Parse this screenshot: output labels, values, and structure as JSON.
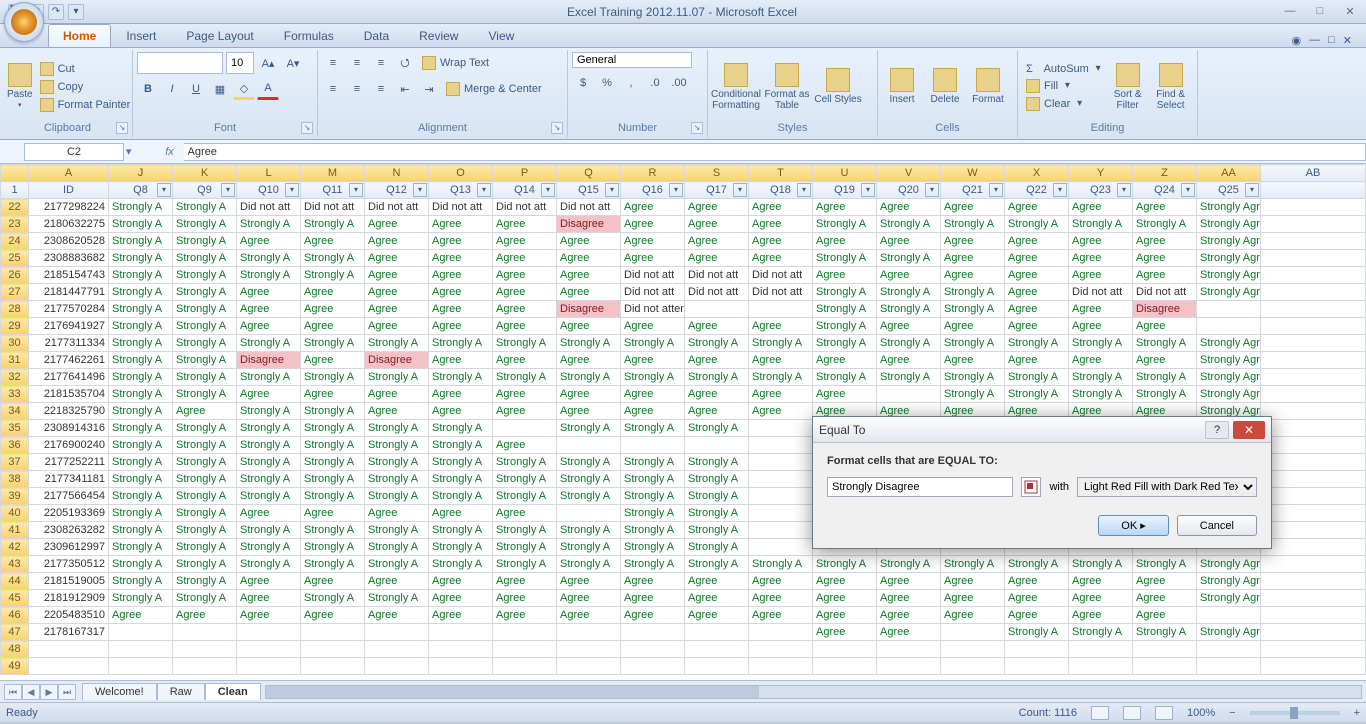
{
  "title": "Excel Training 2012.11.07 - Microsoft Excel",
  "tabs": [
    "Home",
    "Insert",
    "Page Layout",
    "Formulas",
    "Data",
    "Review",
    "View"
  ],
  "clipboard": {
    "paste": "Paste",
    "cut": "Cut",
    "copy": "Copy",
    "fp": "Format Painter",
    "label": "Clipboard"
  },
  "font_group": {
    "font": "",
    "size": "10",
    "label": "Font"
  },
  "align_group": {
    "wrap": "Wrap Text",
    "merge": "Merge & Center",
    "label": "Alignment"
  },
  "num_group": {
    "style": "General",
    "label": "Number"
  },
  "styles_group": {
    "cf": "Conditional Formatting",
    "fat": "Format as Table",
    "cs": "Cell Styles",
    "label": "Styles"
  },
  "cells_group": {
    "ins": "Insert",
    "del": "Delete",
    "fmt": "Format",
    "label": "Cells"
  },
  "edit_group": {
    "as": "AutoSum",
    "fill": "Fill",
    "clear": "Clear",
    "sort": "Sort & Filter",
    "find": "Find & Select",
    "label": "Editing"
  },
  "namebox": "C2",
  "formula": "Agree",
  "col_letters": [
    "",
    "A",
    "J",
    "K",
    "L",
    "M",
    "N",
    "O",
    "P",
    "Q",
    "R",
    "S",
    "T",
    "U",
    "V",
    "W",
    "X",
    "Y",
    "Z",
    "AA",
    "AB"
  ],
  "headers": [
    "",
    "ID",
    "Q8",
    "Q9",
    "Q10",
    "Q11",
    "Q12",
    "Q13",
    "Q14",
    "Q15",
    "Q16",
    "Q17",
    "Q18",
    "Q19",
    "Q20",
    "Q21",
    "Q22",
    "Q23",
    "Q24",
    "Q25",
    ""
  ],
  "rows": [
    {
      "n": "1",
      "hdr": true
    },
    {
      "n": "22",
      "id": "2177298224",
      "c": [
        "Strongly A",
        "Strongly A",
        "Did not att",
        "Did not att",
        "Did not att",
        "Did not att",
        "Did not att",
        "Did not att",
        "Agree",
        "Agree",
        "Agree",
        "Agree",
        "Agree",
        "Agree",
        "Agree",
        "Agree",
        "Agree",
        "Strongly Agree"
      ]
    },
    {
      "n": "23",
      "id": "2180632275",
      "c": [
        "Strongly A",
        "Strongly A",
        "Strongly A",
        "Strongly A",
        "Agree",
        "Agree",
        "Agree",
        "Disagree",
        "Agree",
        "Agree",
        "Agree",
        "Strongly A",
        "Strongly A",
        "Strongly A",
        "Strongly A",
        "Strongly A",
        "Strongly A",
        "Strongly Agree"
      ]
    },
    {
      "n": "24",
      "id": "2308620528",
      "c": [
        "Strongly A",
        "Strongly A",
        "Agree",
        "Agree",
        "Agree",
        "Agree",
        "Agree",
        "Agree",
        "Agree",
        "Agree",
        "Agree",
        "Agree",
        "Agree",
        "Agree",
        "Agree",
        "Agree",
        "Agree",
        "Strongly Agree"
      ]
    },
    {
      "n": "25",
      "id": "2308883682",
      "c": [
        "Strongly A",
        "Strongly A",
        "Strongly A",
        "Strongly A",
        "Agree",
        "Agree",
        "Agree",
        "Agree",
        "Agree",
        "Agree",
        "Agree",
        "Strongly A",
        "Strongly A",
        "Agree",
        "Agree",
        "Agree",
        "Agree",
        "Strongly Agree"
      ]
    },
    {
      "n": "26",
      "id": "2185154743",
      "c": [
        "Strongly A",
        "Strongly A",
        "Strongly A",
        "Strongly A",
        "Agree",
        "Agree",
        "Agree",
        "Agree",
        "Did not att",
        "Did not att",
        "Did not att",
        "Agree",
        "Agree",
        "Agree",
        "Agree",
        "Agree",
        "Agree",
        "Strongly Agree"
      ]
    },
    {
      "n": "27",
      "id": "2181447791",
      "c": [
        "Strongly A",
        "Strongly A",
        "Agree",
        "Agree",
        "Agree",
        "Agree",
        "Agree",
        "Agree",
        "Did not att",
        "Did not att",
        "Did not att",
        "Strongly A",
        "Strongly A",
        "Strongly A",
        "Agree",
        "Did not att",
        "Did not att",
        "Strongly Agree"
      ]
    },
    {
      "n": "28",
      "id": "2177570284",
      "c": [
        "Strongly A",
        "Strongly A",
        "Agree",
        "Agree",
        "Agree",
        "Agree",
        "Agree",
        "Disagree",
        "Did not attend",
        "",
        "",
        "Strongly A",
        "Strongly A",
        "Strongly A",
        "Agree",
        "Agree",
        "Disagree",
        ""
      ]
    },
    {
      "n": "29",
      "id": "2176941927",
      "c": [
        "Strongly A",
        "Strongly A",
        "Agree",
        "Agree",
        "Agree",
        "Agree",
        "Agree",
        "Agree",
        "Agree",
        "Agree",
        "Agree",
        "Strongly A",
        "Agree",
        "Agree",
        "Agree",
        "Agree",
        "Agree",
        ""
      ]
    },
    {
      "n": "30",
      "id": "2177311334",
      "c": [
        "Strongly A",
        "Strongly A",
        "Strongly A",
        "Strongly A",
        "Strongly A",
        "Strongly A",
        "Strongly A",
        "Strongly A",
        "Strongly A",
        "Strongly A",
        "Strongly A",
        "Strongly A",
        "Strongly A",
        "Strongly A",
        "Strongly A",
        "Strongly A",
        "Strongly A",
        "Strongly Agree"
      ]
    },
    {
      "n": "31",
      "id": "2177462261",
      "c": [
        "Strongly A",
        "Strongly A",
        "Disagree",
        "Agree",
        "Disagree",
        "Agree",
        "Agree",
        "Agree",
        "Agree",
        "Agree",
        "Agree",
        "Agree",
        "Agree",
        "Agree",
        "Agree",
        "Agree",
        "Agree",
        "Strongly Agree"
      ]
    },
    {
      "n": "32",
      "id": "2177641496",
      "c": [
        "Strongly A",
        "Strongly A",
        "Strongly A",
        "Strongly A",
        "Strongly A",
        "Strongly A",
        "Strongly A",
        "Strongly A",
        "Strongly A",
        "Strongly A",
        "Strongly A",
        "Strongly A",
        "Strongly A",
        "Strongly A",
        "Strongly A",
        "Strongly A",
        "Strongly A",
        "Strongly Agree"
      ]
    },
    {
      "n": "33",
      "id": "2181535704",
      "c": [
        "Strongly A",
        "Strongly A",
        "Agree",
        "Agree",
        "Agree",
        "Agree",
        "Agree",
        "Agree",
        "Agree",
        "Agree",
        "Agree",
        "Agree",
        "",
        "Strongly A",
        "Strongly A",
        "Strongly A",
        "Strongly A",
        "Strongly Agree"
      ]
    },
    {
      "n": "34",
      "id": "2218325790",
      "c": [
        "Strongly A",
        "Agree",
        "Strongly A",
        "Strongly A",
        "Agree",
        "Agree",
        "Agree",
        "Agree",
        "Agree",
        "Agree",
        "Agree",
        "Agree",
        "Agree",
        "Agree",
        "Agree",
        "Agree",
        "Agree",
        "Strongly Agree"
      ]
    },
    {
      "n": "35",
      "id": "2308914316",
      "c": [
        "Strongly A",
        "Strongly A",
        "Strongly A",
        "Strongly A",
        "Strongly A",
        "Strongly A",
        "",
        "Strongly A",
        "Strongly A",
        "Strongly A",
        "",
        "",
        "",
        "",
        "",
        "",
        "",
        ""
      ]
    },
    {
      "n": "36",
      "id": "2176900240",
      "c": [
        "Strongly A",
        "Strongly A",
        "Strongly A",
        "Strongly A",
        "Strongly A",
        "Strongly A",
        "Agree",
        "",
        "",
        "",
        "",
        "",
        "",
        "",
        "",
        "",
        "",
        ""
      ]
    },
    {
      "n": "37",
      "id": "2177252211",
      "c": [
        "Strongly A",
        "Strongly A",
        "Strongly A",
        "Strongly A",
        "Strongly A",
        "Strongly A",
        "Strongly A",
        "Strongly A",
        "Strongly A",
        "Strongly A",
        "",
        "",
        "",
        "",
        "",
        "",
        "",
        ""
      ]
    },
    {
      "n": "38",
      "id": "2177341181",
      "c": [
        "Strongly A",
        "Strongly A",
        "Strongly A",
        "Strongly A",
        "Strongly A",
        "Strongly A",
        "Strongly A",
        "Strongly A",
        "Strongly A",
        "Strongly A",
        "",
        "",
        "",
        "",
        "",
        "",
        "",
        ""
      ]
    },
    {
      "n": "39",
      "id": "2177566454",
      "c": [
        "Strongly A",
        "Strongly A",
        "Strongly A",
        "Strongly A",
        "Strongly A",
        "Strongly A",
        "Strongly A",
        "Strongly A",
        "Strongly A",
        "Strongly A",
        "",
        "",
        "",
        "",
        "",
        "",
        "",
        ""
      ]
    },
    {
      "n": "40",
      "id": "2205193369",
      "c": [
        "Strongly A",
        "Strongly A",
        "Agree",
        "Agree",
        "Agree",
        "Agree",
        "Agree",
        "",
        "Strongly A",
        "Strongly A",
        "",
        "",
        "",
        "",
        "",
        "",
        "",
        ""
      ]
    },
    {
      "n": "41",
      "id": "2308263282",
      "c": [
        "Strongly A",
        "Strongly A",
        "Strongly A",
        "Strongly A",
        "Strongly A",
        "Strongly A",
        "Strongly A",
        "Strongly A",
        "Strongly A",
        "Strongly A",
        "",
        "",
        "",
        "",
        "",
        "",
        "",
        ""
      ]
    },
    {
      "n": "42",
      "id": "2309612997",
      "c": [
        "Strongly A",
        "Strongly A",
        "Strongly A",
        "Strongly A",
        "Strongly A",
        "Strongly A",
        "Strongly A",
        "Strongly A",
        "Strongly A",
        "Strongly A",
        "",
        "",
        "",
        "",
        "",
        "",
        "",
        ""
      ]
    },
    {
      "n": "43",
      "id": "2177350512",
      "c": [
        "Strongly A",
        "Strongly A",
        "Strongly A",
        "Strongly A",
        "Strongly A",
        "Strongly A",
        "Strongly A",
        "Strongly A",
        "Strongly A",
        "Strongly A",
        "Strongly A",
        "Strongly A",
        "Strongly A",
        "Strongly A",
        "Strongly A",
        "Strongly A",
        "Strongly A",
        "Strongly Agree"
      ]
    },
    {
      "n": "44",
      "id": "2181519005",
      "c": [
        "Strongly A",
        "Strongly A",
        "Agree",
        "Agree",
        "Agree",
        "Agree",
        "Agree",
        "Agree",
        "Agree",
        "Agree",
        "Agree",
        "Agree",
        "Agree",
        "Agree",
        "Agree",
        "Agree",
        "Agree",
        "Strongly Agree"
      ]
    },
    {
      "n": "45",
      "id": "2181912909",
      "c": [
        "Strongly A",
        "Strongly A",
        "Agree",
        "Strongly A",
        "Strongly A",
        "Agree",
        "Agree",
        "Agree",
        "Agree",
        "Agree",
        "Agree",
        "Agree",
        "Agree",
        "Agree",
        "Agree",
        "Agree",
        "Agree",
        "Strongly Agree"
      ]
    },
    {
      "n": "46",
      "id": "2205483510",
      "c": [
        "Agree",
        "Agree",
        "Agree",
        "Agree",
        "Agree",
        "Agree",
        "Agree",
        "Agree",
        "Agree",
        "Agree",
        "Agree",
        "Agree",
        "Agree",
        "Agree",
        "Agree",
        "Agree",
        "Agree",
        ""
      ]
    },
    {
      "n": "47",
      "id": "2178167317",
      "c": [
        "",
        "",
        "",
        "",
        "",
        "",
        "",
        "",
        "",
        "",
        "",
        "Agree",
        "Agree",
        "",
        "Strongly A",
        "Strongly A",
        "Strongly A",
        "Strongly Agree"
      ]
    },
    {
      "n": "48",
      "id": "",
      "c": [
        "",
        "",
        "",
        "",
        "",
        "",
        "",
        "",
        "",
        "",
        "",
        "",
        "",
        "",
        "",
        "",
        "",
        ""
      ]
    },
    {
      "n": "49",
      "id": "",
      "c": [
        "",
        "",
        "",
        "",
        "",
        "",
        "",
        "",
        "",
        "",
        "",
        "",
        "",
        "",
        "",
        "",
        "",
        ""
      ]
    }
  ],
  "sheets": [
    "Welcome!",
    "Raw",
    "Clean"
  ],
  "status": {
    "ready": "Ready",
    "count_label": "Count:",
    "count": "1116",
    "zoom": "100%"
  },
  "dialog": {
    "title": "Equal To",
    "prompt": "Format cells that are EQUAL TO:",
    "value": "Strongly Disagree",
    "with_label": "with",
    "format_option": "Light Red Fill with Dark Red Text",
    "ok": "OK",
    "cancel": "Cancel"
  }
}
